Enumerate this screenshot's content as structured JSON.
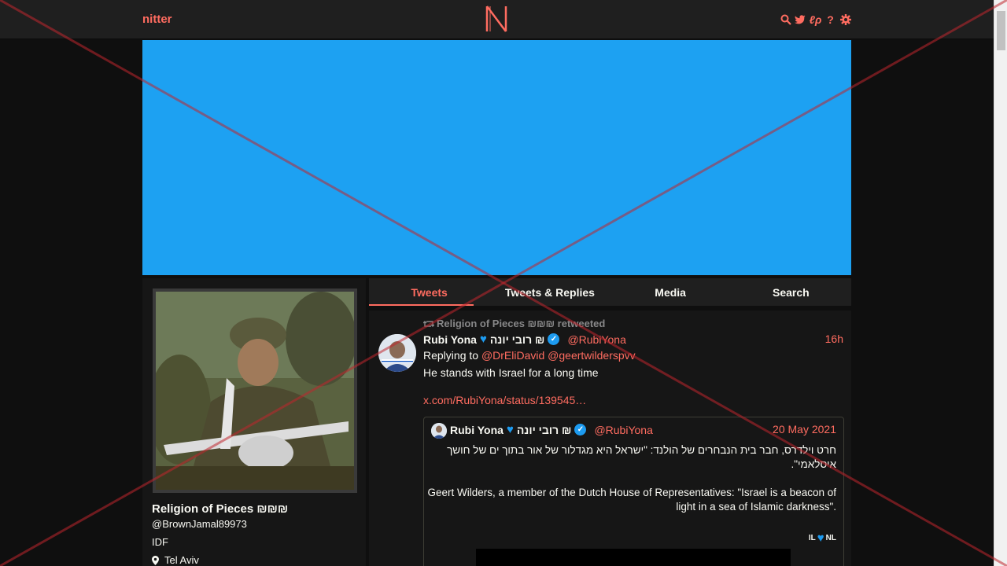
{
  "nav": {
    "brand": "nitter",
    "icons": [
      "search-icon",
      "bird-icon",
      "rss-icon",
      "help-icon",
      "settings-icon"
    ],
    "accent": "#ff6c60"
  },
  "banner": {
    "color": "#1da1f2"
  },
  "profile": {
    "name": "Religion of Pieces ₪₪₪",
    "handle": "@BrownJamal89973",
    "bio": "IDF",
    "location": "Tel Aviv"
  },
  "tabs": [
    "Tweets",
    "Tweets & Replies",
    "Media",
    "Search"
  ],
  "active_tab": "Tweets",
  "tweet": {
    "retweet_label": "Religion of Pieces ₪₪₪ retweeted",
    "fullname": "Rubi Yona",
    "fullname_hebrew": "רובי יונה ₪",
    "username": "@RubiYona",
    "date": "16h",
    "replying_label": "Replying to",
    "reply_to": [
      "@DrEliDavid",
      "@geertwilderspvv"
    ],
    "text": "He stands with Israel for a long time",
    "link": "x.com/RubiYona/status/139545…",
    "quote": {
      "fullname": "Rubi Yona",
      "fullname_hebrew": "רובי יונה ₪",
      "username": "@RubiYona",
      "date": "20 May 2021",
      "hebrew_text": "חרט וילדרס, חבר בית הנבחרים של הולנד: \"ישראל היא מגדלור של אור בתוך ים של חושך איסלאמי\".",
      "english_text": "Geert Wilders, a member of the Dutch House of Representatives: \"Israel is a beacon of light in a sea of Islamic darkness\".",
      "flags_left": "IL",
      "flags_right": "NL"
    }
  }
}
